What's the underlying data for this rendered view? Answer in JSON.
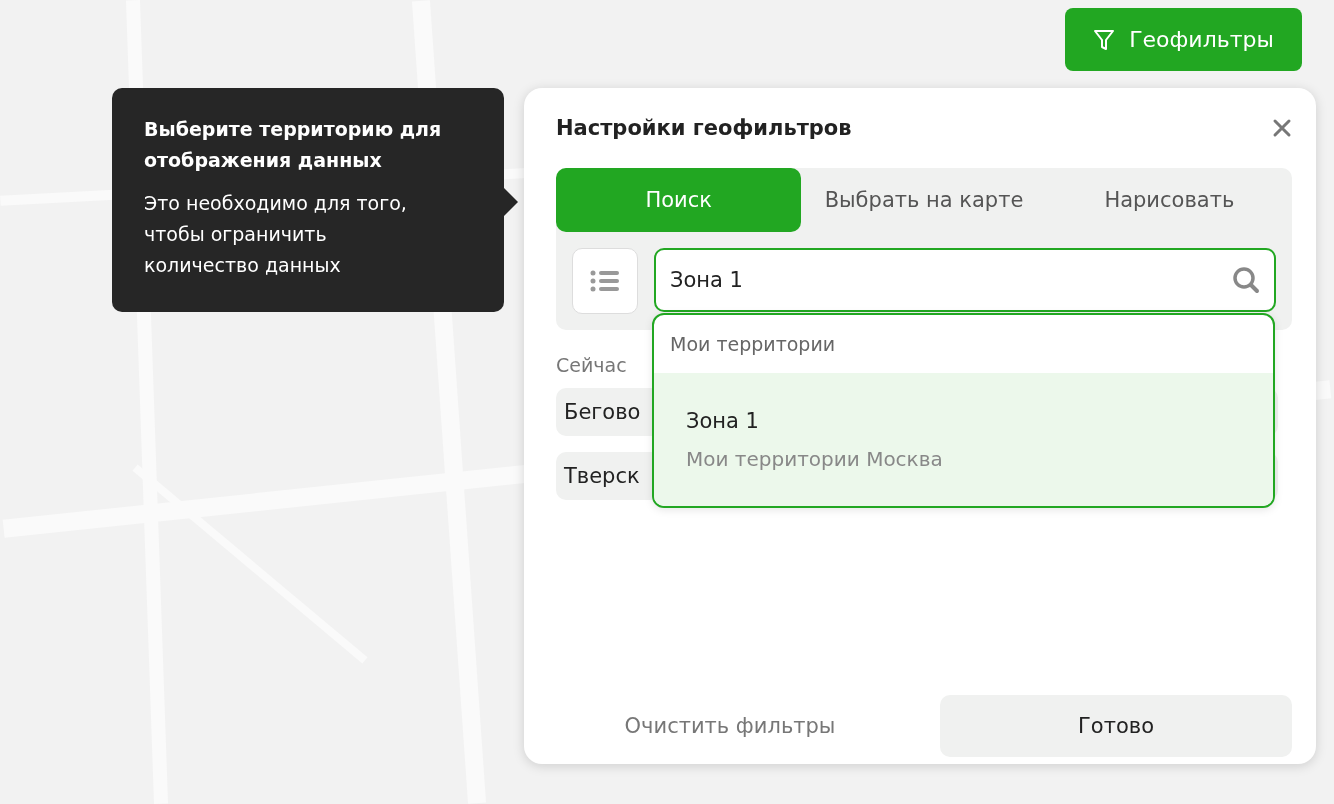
{
  "geofilter_button": {
    "label": "Геофильтры"
  },
  "tooltip": {
    "title": "Выберите территорию для отображения данных",
    "text": "Это необходимо для того, чтобы ограничить количество данных"
  },
  "panel": {
    "title": "Настройки геофильтров",
    "tabs": [
      {
        "label": "Поиск",
        "selected": true
      },
      {
        "label": "Выбрать на карте",
        "selected": false
      },
      {
        "label": "Нарисовать",
        "selected": false
      }
    ],
    "search": {
      "value": "Зона 1"
    },
    "current_label": "Сейчас",
    "chips": [
      "Бегово",
      "Тверск"
    ],
    "dropdown": {
      "header": "Мои территории",
      "items": [
        {
          "title": "Зона 1",
          "subtitle": "Мои территории Москва",
          "selected": true
        }
      ]
    },
    "buttons": {
      "clear": "Очистить фильтры",
      "done": "Готово"
    }
  }
}
